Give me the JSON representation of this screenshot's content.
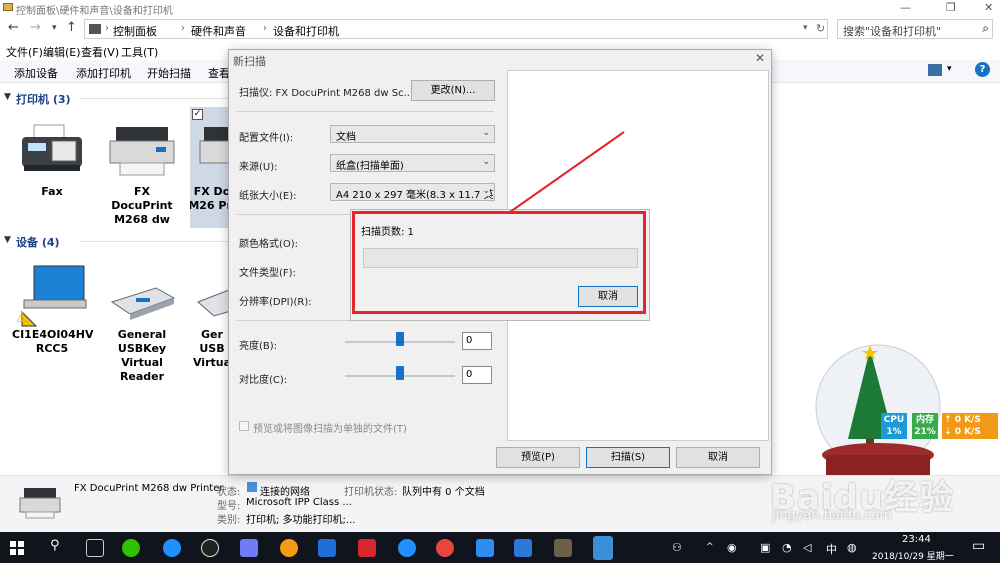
{
  "window": {
    "title": "控制面板\\硬件和声音\\设备和打印机"
  },
  "address": {
    "crumbs": [
      "控制面板",
      "硬件和声音",
      "设备和打印机"
    ],
    "search_placeholder": "搜索\"设备和打印机\""
  },
  "menu": [
    "文件(F)",
    "编辑(E)",
    "查看(V)",
    "工具(T)"
  ],
  "commands": [
    "添加设备",
    "添加打印机",
    "开始扫描",
    "查看"
  ],
  "groups": {
    "printers": {
      "title": "打印机 (3)",
      "items": [
        "Fax",
        "FX DocuPrint M268 dw",
        "FX Do M26 Pri"
      ]
    },
    "devices": {
      "title": "设备 (4)",
      "items": [
        "CI1E4OI04HV RCC5",
        "General USBKey Virtual Reader",
        "Ger USB Virtua"
      ]
    }
  },
  "details": {
    "device_name": "FX DocuPrint M268 dw Printer",
    "rows": [
      {
        "key": "状态:",
        "value": "连接的网络"
      },
      {
        "key": "型号:",
        "value": "Microsoft IPP Class ..."
      },
      {
        "key": "类别:",
        "value": "打印机; 多功能打印机;..."
      }
    ],
    "print_status_key": "打印机状态:",
    "print_status_value": "队列中有 0 个文档"
  },
  "dialog": {
    "title": "新扫描",
    "scanner_label": "扫描仪: FX DocuPrint M268 dw Sc...",
    "change_button": "更改(N)...",
    "profile": {
      "label": "配置文件(I):",
      "value": "文档"
    },
    "source": {
      "label": "来源(U):",
      "value": "纸盒(扫描单面)"
    },
    "paper_size": {
      "label": "纸张大小(E):",
      "value": "A4 210 x 297 毫米(8.3 x 11.7 英寸"
    },
    "color_format_label": "颜色格式(O):",
    "file_type_label": "文件类型(F):",
    "resolution_label": "分辨率(DPI)(R):",
    "brightness": {
      "label": "亮度(B):",
      "value": "0"
    },
    "contrast": {
      "label": "对比度(C):",
      "value": "0"
    },
    "preview_checkbox": "预览或将图像扫描为单独的文件(T)",
    "buttons": {
      "preview": "预览(P)",
      "scan": "扫描(S)",
      "cancel": "取消"
    }
  },
  "progress": {
    "pages_label": "扫描页数: 1",
    "cancel": "取消",
    "fraction": 0.0
  },
  "gadget": {
    "cpu_label": "CPU",
    "cpu_value": "1%",
    "mem_label": "内存",
    "mem_value": "21%",
    "up": "0 K/S",
    "down": "0 K/S"
  },
  "taskbar": {
    "time": "23:44",
    "date": "2018/10/29 星期一",
    "ime": "中"
  },
  "watermark": {
    "brand": "Baidu经验",
    "url": "jingyan.baidu.com"
  },
  "colors": {
    "highlight": "#e8232d",
    "accent": "#1672c8"
  }
}
